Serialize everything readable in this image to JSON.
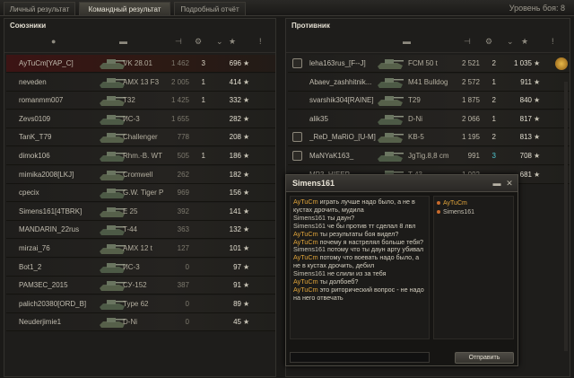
{
  "tabs": [
    "Личный результат",
    "Командный результат",
    "Подробный отчёт"
  ],
  "level": "Уровень боя: 8",
  "allies": {
    "title": "Союзники",
    "rows": [
      {
        "name": "AyTuCm[YAP_C]",
        "tank": "VK 28.01",
        "dmg": "1 462",
        "kills": "3",
        "xp": "696",
        "self": true
      },
      {
        "name": "neveden",
        "tank": "AMX 13 F3",
        "dmg": "2 005",
        "kills": "1",
        "xp": "414"
      },
      {
        "name": "romanmm007",
        "tank": "T32",
        "dmg": "1 425",
        "kills": "1",
        "xp": "332"
      },
      {
        "name": "Zevs0109",
        "tank": "ИС-3",
        "dmg": "1 655",
        "kills": "",
        "xp": "282"
      },
      {
        "name": "TanK_T79",
        "tank": "Challenger",
        "dmg": "778",
        "kills": "",
        "xp": "208"
      },
      {
        "name": "dimok106",
        "tank": "Rhm.-B. WT",
        "dmg": "505",
        "kills": "1",
        "xp": "186"
      },
      {
        "name": "mimika2008[LKJ]",
        "tank": "Cromwell",
        "dmg": "262",
        "kills": "",
        "xp": "182"
      },
      {
        "name": "cpecix",
        "tank": "G.W. Tiger P",
        "dmg": "969",
        "kills": "",
        "xp": "156"
      },
      {
        "name": "Simens161[4TBRK]",
        "tank": "E 25",
        "dmg": "392",
        "kills": "",
        "xp": "141"
      },
      {
        "name": "MANDARIN_22rus",
        "tank": "T-44",
        "dmg": "363",
        "kills": "",
        "xp": "132"
      },
      {
        "name": "mirzai_76",
        "tank": "AMX 12 t",
        "dmg": "127",
        "kills": "",
        "xp": "101"
      },
      {
        "name": "Bot1_2",
        "tank": "ИС-3",
        "dmg": "0",
        "kills": "",
        "xp": "97"
      },
      {
        "name": "PAM3EC_2015",
        "tank": "СУ-152",
        "dmg": "387",
        "kills": "",
        "xp": "91"
      },
      {
        "name": "palich20380[ORD_B]",
        "tank": "Type 62",
        "dmg": "0",
        "kills": "",
        "xp": "89"
      },
      {
        "name": "Neuderjimie1",
        "tank": "D-Ni",
        "dmg": "0",
        "kills": "",
        "xp": "45"
      }
    ]
  },
  "enemies": {
    "title": "Противник",
    "rows": [
      {
        "name": "leha163rus_[F--J]",
        "tank": "FCM 50 t",
        "dmg": "2 521",
        "kills": "2",
        "xp": "1 035",
        "clan": true,
        "medal": true
      },
      {
        "name": "Abaev_zashhitnik...",
        "tank": "M41 Bulldog",
        "dmg": "2 572",
        "kills": "1",
        "xp": "911"
      },
      {
        "name": "svarshik304[RAINE]",
        "tank": "T29",
        "dmg": "1 875",
        "kills": "2",
        "xp": "840"
      },
      {
        "name": "alik35",
        "tank": "D-Ni",
        "dmg": "2 066",
        "kills": "1",
        "xp": "817"
      },
      {
        "name": "_ReD_MaRiO_[U-M]",
        "tank": "KB-5",
        "dmg": "1 195",
        "kills": "2",
        "xp": "813",
        "clan": true
      },
      {
        "name": "MaNYaK163_",
        "tank": "JgTig.8,8 cm",
        "dmg": "991",
        "kills": "3",
        "xp": "708",
        "clan": true,
        "cyan": true
      },
      {
        "name": "MP3_HIEEP",
        "tank": "T-43",
        "dmg": "1 092",
        "kills": "",
        "xp": "681"
      }
    ]
  },
  "chat": {
    "title": "Simens161",
    "messages": [
      {
        "author": "AyTuCm",
        "text": "играть лучше надо было, а не в кустах дрочить, мудила",
        "self": true
      },
      {
        "author": "Simens161",
        "text": "ты даун?"
      },
      {
        "author": "Simens161",
        "text": "че бы против тт сделал 8 лвл"
      },
      {
        "author": "AyTuCm",
        "text": "ты результаты боя видел?",
        "self": true
      },
      {
        "author": "AyTuCm",
        "text": "почему я настрелял больше тебя?",
        "self": true
      },
      {
        "author": "Simens161",
        "text": "потому что ты даун арту убивал"
      },
      {
        "author": "AyTuCm",
        "text": "потому что воевать надо было, а не в кустах дрочить, дебил",
        "self": true
      },
      {
        "author": "Simens161",
        "text": "не слили из за тебя"
      },
      {
        "author": "AyTuCm",
        "text": "ты долбоеб?",
        "self": true
      },
      {
        "author": "AyTuCm",
        "text": "это риторический вопрос - не надо на него отвечать",
        "self": true
      }
    ],
    "members": [
      "AyTuCm",
      "Simens161"
    ],
    "send_label": "Отправить"
  }
}
